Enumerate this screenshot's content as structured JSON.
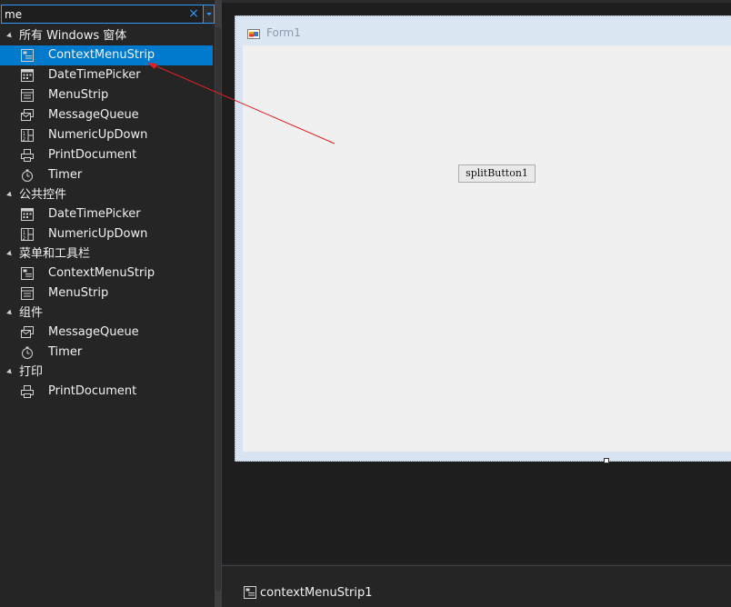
{
  "search": {
    "value": "me"
  },
  "categories": [
    {
      "label": "所有 Windows 窗体",
      "items": [
        {
          "label": "ContextMenuStrip",
          "icon": "context-menu-strip-icon",
          "selected": true
        },
        {
          "label": "DateTimePicker",
          "icon": "date-time-picker-icon"
        },
        {
          "label": "MenuStrip",
          "icon": "menu-strip-icon"
        },
        {
          "label": "MessageQueue",
          "icon": "message-queue-icon"
        },
        {
          "label": "NumericUpDown",
          "icon": "numeric-updown-icon"
        },
        {
          "label": "PrintDocument",
          "icon": "print-document-icon"
        },
        {
          "label": "Timer",
          "icon": "timer-icon"
        }
      ]
    },
    {
      "label": "公共控件",
      "items": [
        {
          "label": "DateTimePicker",
          "icon": "date-time-picker-icon"
        },
        {
          "label": "NumericUpDown",
          "icon": "numeric-updown-icon"
        }
      ]
    },
    {
      "label": "菜单和工具栏",
      "items": [
        {
          "label": "ContextMenuStrip",
          "icon": "context-menu-strip-icon"
        },
        {
          "label": "MenuStrip",
          "icon": "menu-strip-icon"
        }
      ]
    },
    {
      "label": "组件",
      "items": [
        {
          "label": "MessageQueue",
          "icon": "message-queue-icon"
        },
        {
          "label": "Timer",
          "icon": "timer-icon"
        }
      ]
    },
    {
      "label": "打印",
      "items": [
        {
          "label": "PrintDocument",
          "icon": "print-document-icon"
        }
      ]
    }
  ],
  "form": {
    "title": "Form1",
    "split_button_label": "splitButton1"
  },
  "tray": {
    "component_label": "contextMenuStrip1",
    "icon": "context-menu-strip-icon"
  },
  "colors": {
    "selection": "#007acc",
    "search_border": "#3399ff",
    "annotation_arrow": "#e02020"
  }
}
